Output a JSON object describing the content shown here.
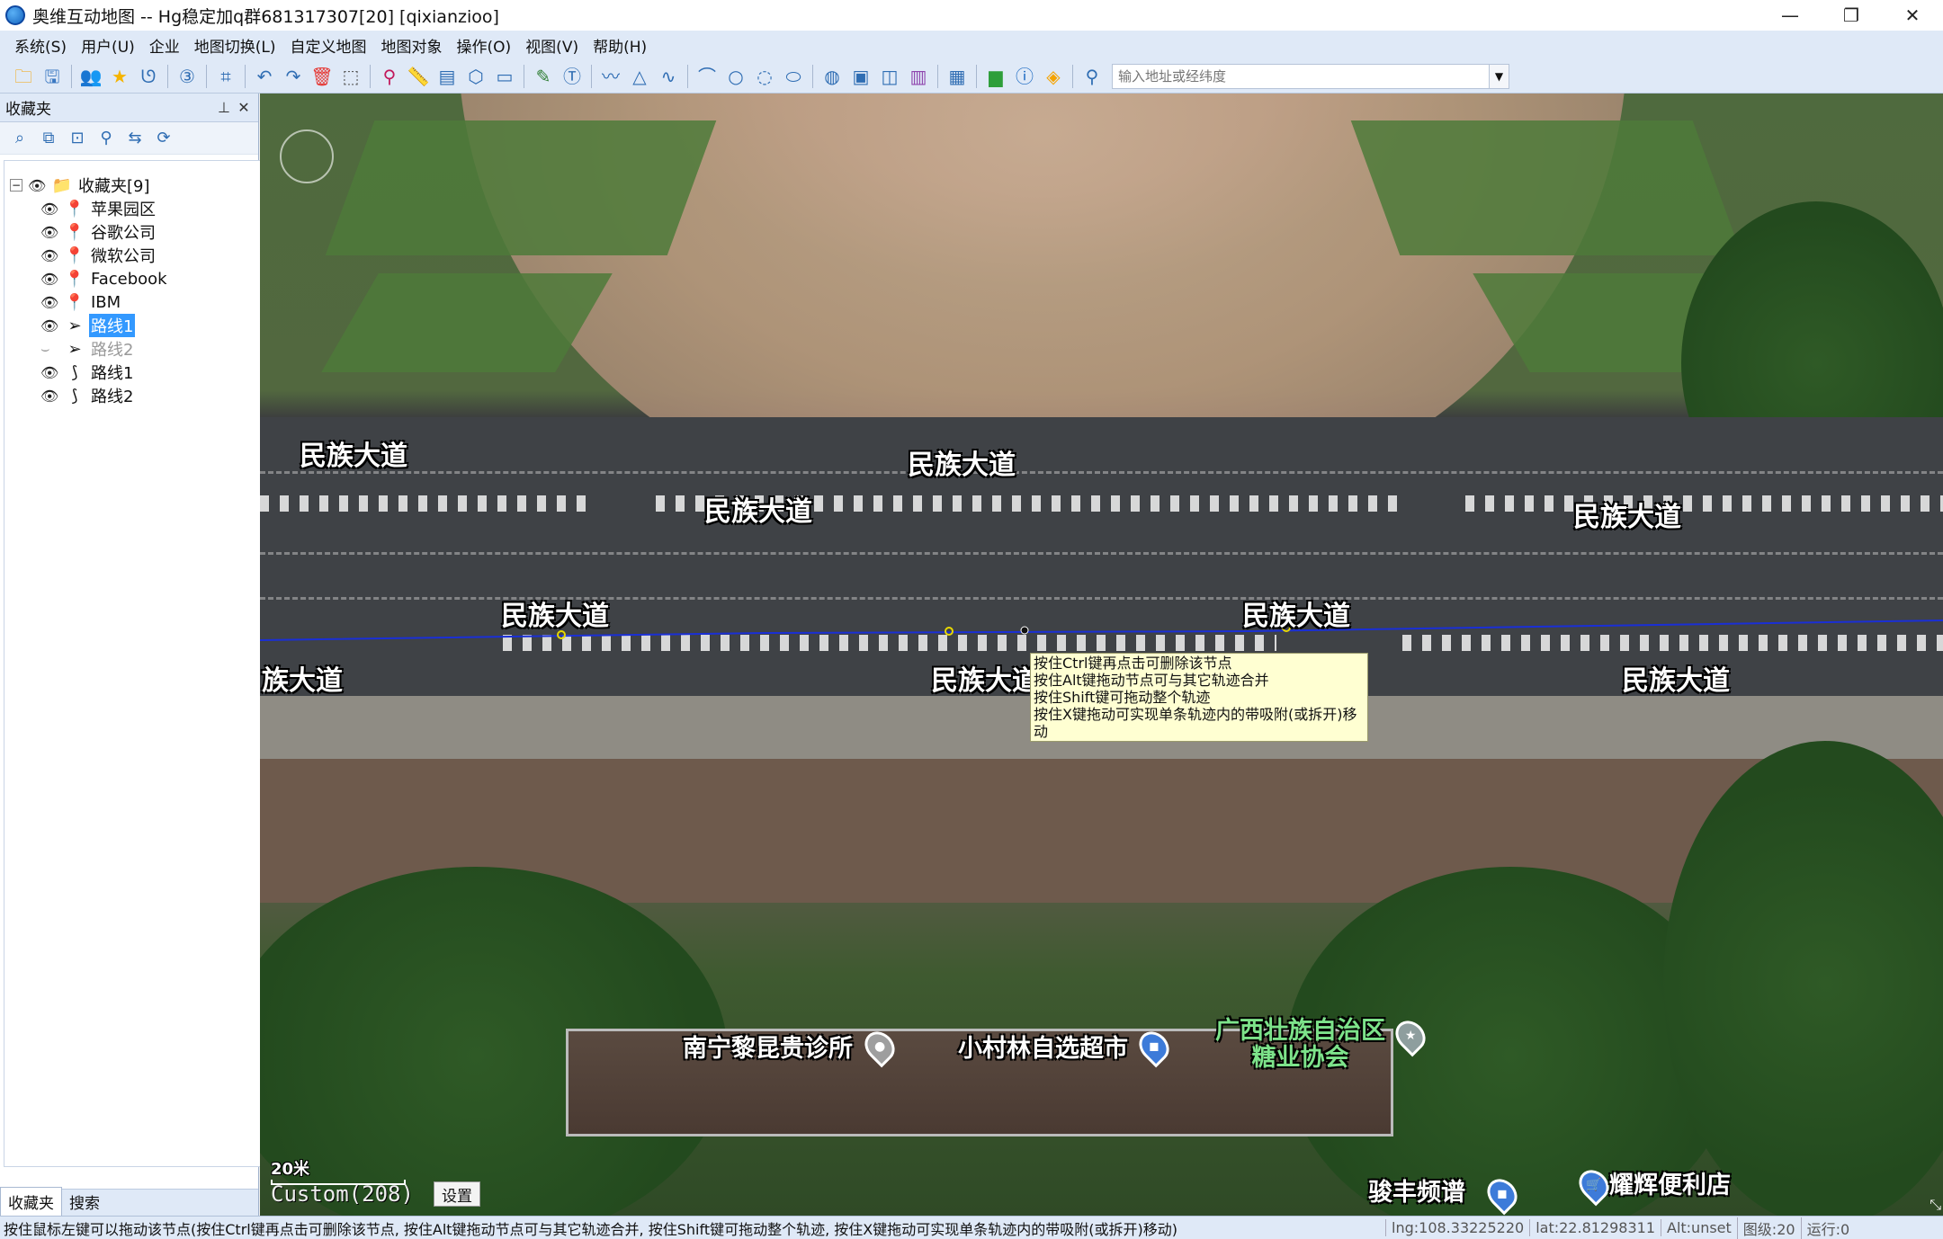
{
  "window": {
    "title": "奥维互动地图 -- Hg稳定加q群681317307[20] [qixianzioo]",
    "controls": [
      "—",
      "❐",
      "✕"
    ]
  },
  "menu": [
    "系统(S)",
    "用户(U)",
    "企业",
    "地图切换(L)",
    "自定义地图",
    "地图对象",
    "操作(O)",
    "视图(V)",
    "帮助(H)"
  ],
  "toolbar": {
    "search_placeholder": "输入地址或经纬度"
  },
  "sidebar": {
    "title": "收藏夹",
    "pin": "📌",
    "close": "✕",
    "tree": [
      {
        "label": "收藏夹[9]",
        "icon": "folder-icon",
        "glyph": "📁",
        "level": 0,
        "visible": true
      },
      {
        "label": "苹果园区",
        "icon": "marker-icon",
        "glyph": "📍",
        "level": 1,
        "visible": true
      },
      {
        "label": "谷歌公司",
        "icon": "marker-icon",
        "glyph": "📍",
        "level": 1,
        "visible": true
      },
      {
        "label": "微软公司",
        "icon": "marker-icon",
        "glyph": "📍",
        "level": 1,
        "visible": true
      },
      {
        "label": "Facebook",
        "icon": "marker-icon",
        "glyph": "📍",
        "level": 1,
        "visible": true
      },
      {
        "label": "IBM",
        "icon": "marker-icon",
        "glyph": "📍",
        "level": 1,
        "visible": true
      },
      {
        "label": "路线1",
        "icon": "navigate-icon",
        "glyph": "➤",
        "level": 1,
        "visible": true,
        "selected": true
      },
      {
        "label": "路线2",
        "icon": "navigate-icon",
        "glyph": "➤",
        "level": 1,
        "visible": false
      },
      {
        "label": "路线1",
        "icon": "route-icon",
        "glyph": "⟆",
        "level": 1,
        "visible": true
      },
      {
        "label": "路线2",
        "icon": "route-icon",
        "glyph": "⟆",
        "level": 1,
        "visible": true
      }
    ],
    "tabs": [
      "收藏夹",
      "搜索"
    ]
  },
  "map": {
    "road_name": "民族大道",
    "road_name_cut": "族大道",
    "road_name_cut2": "民族大道",
    "pois": {
      "clinic": "南宁黎昆贵诊所",
      "supermarket": "小村林自选超市",
      "sugar_assoc": "广西壮族自治区\n糖业协会",
      "shop": "耀辉便利店",
      "music": "骏丰频谱"
    },
    "tooltip": [
      "按住Ctrl键再点击可删除该节点",
      "按住Alt键拖动节点可与其它轨迹合并",
      "按住Shift键可拖动整个轨迹",
      "按住X键拖动可实现单条轨迹内的带吸附(或拆开)移动"
    ],
    "scale": "20米",
    "map_type": "Custom(208)",
    "settings": "设置"
  },
  "status": {
    "message": "按住鼠标左键可以拖动该节点(按住Ctrl键再点击可删除该节点, 按住Alt键拖动节点可与其它轨迹合并, 按住Shift键可拖动整个轨迹, 按住X键拖动可实现单条轨迹内的带吸附(或拆开)移动)",
    "lng": "lng:108.33225220",
    "lat": "lat:22.81298311",
    "alt": "Alt:unset",
    "level": "图级:20",
    "run": "运行:0"
  }
}
